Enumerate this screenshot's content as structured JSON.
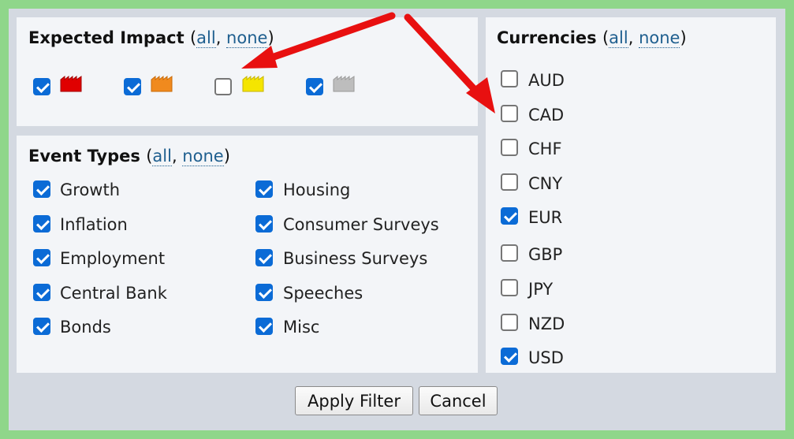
{
  "impact": {
    "title": "Expected Impact",
    "all": "all",
    "none": "none",
    "levels": [
      {
        "icon": "impact-high-icon",
        "color": "#e00000",
        "checked": true
      },
      {
        "icon": "impact-medium-icon",
        "color": "#f08a1e",
        "checked": true
      },
      {
        "icon": "impact-low-icon",
        "color": "#f5e500",
        "checked": false
      },
      {
        "icon": "impact-non-economic-icon",
        "color": "#bdbdbd",
        "checked": true
      }
    ]
  },
  "events": {
    "title": "Event Types",
    "all": "all",
    "none": "none",
    "items": [
      {
        "label": "Growth",
        "checked": true
      },
      {
        "label": "Inflation",
        "checked": true
      },
      {
        "label": "Employment",
        "checked": true
      },
      {
        "label": "Central Bank",
        "checked": true
      },
      {
        "label": "Bonds",
        "checked": true
      },
      {
        "label": "Housing",
        "checked": true
      },
      {
        "label": "Consumer Surveys",
        "checked": true
      },
      {
        "label": "Business Surveys",
        "checked": true
      },
      {
        "label": "Speeches",
        "checked": true
      },
      {
        "label": "Misc",
        "checked": true
      }
    ]
  },
  "currencies": {
    "title": "Currencies",
    "all": "all",
    "none": "none",
    "items": [
      {
        "label": "AUD",
        "checked": false
      },
      {
        "label": "CAD",
        "checked": false
      },
      {
        "label": "CHF",
        "checked": false
      },
      {
        "label": "CNY",
        "checked": false
      },
      {
        "label": "EUR",
        "checked": true
      },
      {
        "label": "GBP",
        "checked": false
      },
      {
        "label": "JPY",
        "checked": false
      },
      {
        "label": "NZD",
        "checked": false
      },
      {
        "label": "USD",
        "checked": true
      }
    ]
  },
  "buttons": {
    "apply": "Apply Filter",
    "cancel": "Cancel"
  },
  "annotation_color": "#e81010"
}
